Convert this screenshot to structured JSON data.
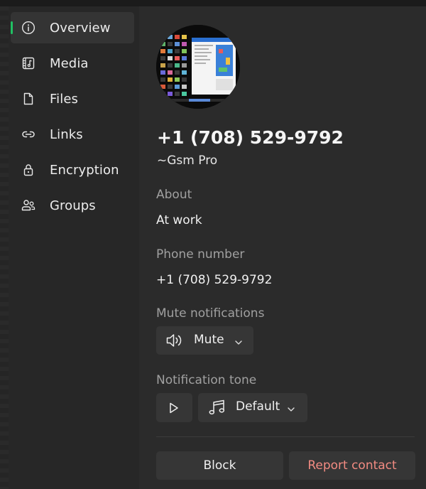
{
  "nav": {
    "items": [
      {
        "label": "Overview",
        "icon": "info-icon",
        "active": true
      },
      {
        "label": "Media",
        "icon": "media-icon",
        "active": false
      },
      {
        "label": "Files",
        "icon": "file-icon",
        "active": false
      },
      {
        "label": "Links",
        "icon": "link-icon",
        "active": false
      },
      {
        "label": "Encryption",
        "icon": "lock-icon",
        "active": false
      },
      {
        "label": "Groups",
        "icon": "people-icon",
        "active": false
      }
    ]
  },
  "contact": {
    "name": "+1 (708) 529-9792",
    "subname": "~Gsm Pro",
    "about_label": "About",
    "about_value": "At work",
    "phone_label": "Phone number",
    "phone_value": "+1 (708) 529-9792"
  },
  "mute": {
    "label": "Mute notifications",
    "button_label": "Mute",
    "icon": "speaker-icon"
  },
  "tone": {
    "label": "Notification tone",
    "play_icon": "play-icon",
    "select_label": "Default",
    "select_icon": "music-note-icon"
  },
  "actions": {
    "block_label": "Block",
    "report_label": "Report contact"
  },
  "colors": {
    "accent": "#21c063",
    "danger": "#f28b82",
    "background": "#2b2b2b",
    "sidebar": "#272727"
  }
}
